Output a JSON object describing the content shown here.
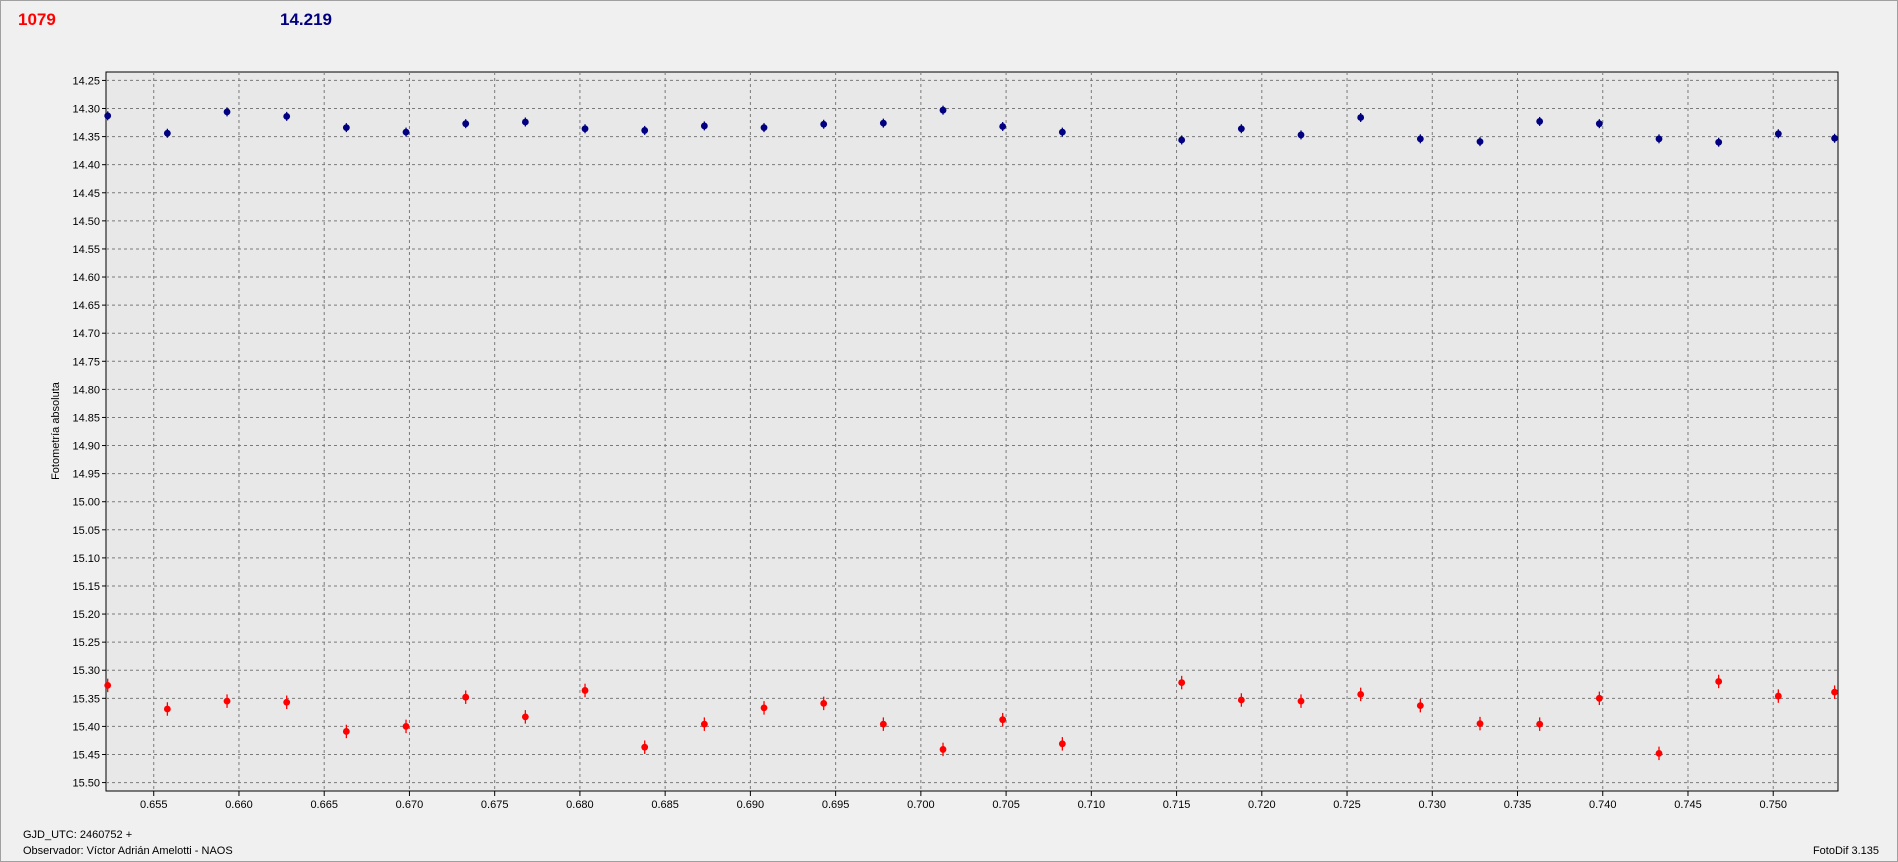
{
  "header": {
    "left_value": "1079",
    "right_value": "14.219",
    "left_color": "#ff0000",
    "right_color": "#000080"
  },
  "footer": {
    "gjd": "GJD_UTC: 2460752 +",
    "observer": "Observador: Víctor Adrián Amelotti - NAOS",
    "version": "FotoDif 3.135"
  },
  "chart_data": {
    "type": "scatter",
    "ylabel": "Fotometría absoluta",
    "xlabel": "",
    "xlim": [
      0.6522,
      0.7538
    ],
    "ylim": [
      14.235,
      15.515
    ],
    "y_inverted": true,
    "grid": true,
    "x_ticks": [
      "0.655",
      "0.660",
      "0.665",
      "0.670",
      "0.675",
      "0.680",
      "0.685",
      "0.690",
      "0.695",
      "0.700",
      "0.705",
      "0.710",
      "0.715",
      "0.720",
      "0.725",
      "0.730",
      "0.735",
      "0.740",
      "0.745",
      "0.750"
    ],
    "y_ticks": [
      "14.25",
      "14.30",
      "14.35",
      "14.40",
      "14.45",
      "14.50",
      "14.55",
      "14.60",
      "14.65",
      "14.70",
      "14.75",
      "14.80",
      "14.85",
      "14.90",
      "14.95",
      "15.00",
      "15.05",
      "15.10",
      "15.15",
      "15.20",
      "15.25",
      "15.30",
      "15.35",
      "15.40",
      "15.45",
      "15.50"
    ],
    "series": [
      {
        "color": "#000080",
        "error": 0.008,
        "x": [
          0.6523,
          0.6558,
          0.6593,
          0.6628,
          0.6663,
          0.6698,
          0.6733,
          0.6768,
          0.6803,
          0.6838,
          0.6873,
          0.6908,
          0.6943,
          0.6978,
          0.7013,
          0.7048,
          0.7083,
          0.7153,
          0.7188,
          0.7223,
          0.7258,
          0.7293,
          0.7328,
          0.7363,
          0.7398,
          0.7433,
          0.7468,
          0.7503,
          0.7536
        ],
        "y": [
          14.313,
          14.344,
          14.306,
          14.314,
          14.334,
          14.342,
          14.327,
          14.324,
          14.336,
          14.339,
          14.331,
          14.334,
          14.328,
          14.326,
          14.303,
          14.332,
          14.342,
          14.356,
          14.336,
          14.347,
          14.316,
          14.354,
          14.359,
          14.323,
          14.327,
          14.354,
          14.36,
          14.345,
          14.353
        ]
      },
      {
        "color": "#ff0000",
        "error": 0.012,
        "x": [
          0.6523,
          0.6558,
          0.6593,
          0.6628,
          0.6663,
          0.6698,
          0.6733,
          0.6768,
          0.6803,
          0.6838,
          0.6873,
          0.6908,
          0.6943,
          0.6978,
          0.7013,
          0.7048,
          0.7083,
          0.7153,
          0.7188,
          0.7223,
          0.7258,
          0.7293,
          0.7328,
          0.7363,
          0.7398,
          0.7433,
          0.7468,
          0.7503,
          0.7536
        ],
        "y": [
          15.327,
          15.369,
          15.355,
          15.357,
          15.409,
          15.4,
          15.348,
          15.383,
          15.336,
          15.437,
          15.396,
          15.367,
          15.359,
          15.396,
          15.441,
          15.388,
          15.431,
          15.322,
          15.353,
          15.355,
          15.343,
          15.363,
          15.395,
          15.396,
          15.35,
          15.448,
          15.32,
          15.346,
          15.339
        ]
      }
    ]
  }
}
